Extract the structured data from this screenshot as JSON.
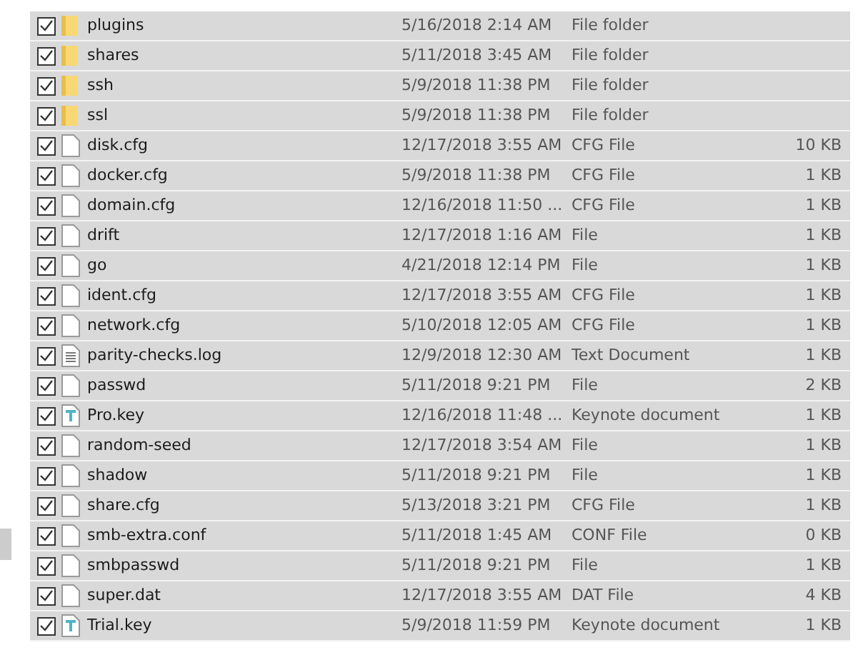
{
  "files": [
    {
      "name": "plugins",
      "date": "5/16/2018 2:14 AM",
      "type": "File folder",
      "kind": "folder",
      "checked": true,
      "selected": true
    },
    {
      "name": "shares",
      "date": "5/11/2018 3:45 AM",
      "type": "File folder",
      "kind": "folder",
      "checked": true,
      "selected": true
    },
    {
      "name": "ssh",
      "date": "5/9/2018 11:38 PM",
      "type": "File folder",
      "kind": "folder",
      "checked": true,
      "selected": true
    },
    {
      "name": "ssl",
      "date": "5/9/2018 11:38 PM",
      "type": "File folder",
      "kind": "folder",
      "checked": true,
      "selected": true
    },
    {
      "name": "disk.cfg",
      "date": "12/17/2018 3:55 AM",
      "type": "CFG File",
      "size": "10 KB",
      "kind": "file",
      "checked": true,
      "selected": true
    },
    {
      "name": "docker.cfg",
      "date": "5/9/2018 11:38 PM",
      "type": "CFG File",
      "size": "1 KB",
      "kind": "file",
      "checked": true,
      "selected": true
    },
    {
      "name": "domain.cfg",
      "date": "12/16/2018 11:50 ...",
      "type": "CFG File",
      "size": "1 KB",
      "kind": "file",
      "checked": true,
      "selected": true
    },
    {
      "name": "drift",
      "date": "12/17/2018 1:16 AM",
      "type": "File",
      "size": "1 KB",
      "kind": "file",
      "checked": true,
      "selected": true
    },
    {
      "name": "go",
      "date": "4/21/2018 12:14 PM",
      "type": "File",
      "size": "1 KB",
      "kind": "file",
      "checked": true,
      "selected": true
    },
    {
      "name": "ident.cfg",
      "date": "12/17/2018 3:55 AM",
      "type": "CFG File",
      "size": "1 KB",
      "kind": "file",
      "checked": true,
      "selected": true
    },
    {
      "name": "network.cfg",
      "date": "5/10/2018 12:05 AM",
      "type": "CFG File",
      "size": "1 KB",
      "kind": "file",
      "checked": true,
      "selected": true
    },
    {
      "name": "parity-checks.log",
      "date": "12/9/2018 12:30 AM",
      "type": "Text Document",
      "size": "1 KB",
      "kind": "text",
      "checked": true,
      "selected": true
    },
    {
      "name": "passwd",
      "date": "5/11/2018 9:21 PM",
      "type": "File",
      "size": "2 KB",
      "kind": "file",
      "checked": true,
      "selected": true
    },
    {
      "name": "Pro.key",
      "date": "12/16/2018 11:48 ...",
      "type": "Keynote document",
      "size": "1 KB",
      "kind": "keynote",
      "checked": true,
      "selected": true
    },
    {
      "name": "random-seed",
      "date": "12/17/2018 3:54 AM",
      "type": "File",
      "size": "1 KB",
      "kind": "file",
      "checked": true,
      "selected": true
    },
    {
      "name": "shadow",
      "date": "5/11/2018 9:21 PM",
      "type": "File",
      "size": "1 KB",
      "kind": "file",
      "checked": true,
      "selected": true
    },
    {
      "name": "share.cfg",
      "date": "5/13/2018 3:21 PM",
      "type": "CFG File",
      "size": "1 KB",
      "kind": "file",
      "checked": true,
      "selected": true
    },
    {
      "name": "smb-extra.conf",
      "date": "5/11/2018 1:45 AM",
      "type": "CONF File",
      "size": "0 KB",
      "kind": "file",
      "checked": true,
      "selected": true
    },
    {
      "name": "smbpasswd",
      "date": "5/11/2018 9:21 PM",
      "type": "File",
      "size": "1 KB",
      "kind": "file",
      "checked": true,
      "selected": true
    },
    {
      "name": "super.dat",
      "date": "12/17/2018 3:55 AM",
      "type": "DAT File",
      "size": "4 KB",
      "kind": "file",
      "checked": true,
      "selected": true
    },
    {
      "name": "Trial.key",
      "date": "5/9/2018 11:59 PM",
      "type": "Keynote document",
      "size": "1 KB",
      "kind": "keynote",
      "checked": true,
      "selected": true
    }
  ]
}
